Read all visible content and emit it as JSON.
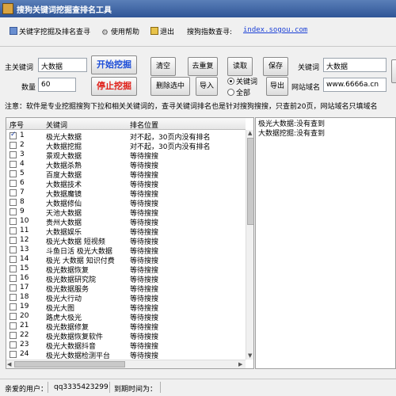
{
  "window": {
    "title": "搜狗关键词挖掘查排名工具"
  },
  "menu": {
    "item1": "关键字挖掘及排名查寻",
    "item2": "使用帮助",
    "item3": "退出",
    "index_label": "搜狗指数查寻:",
    "index_link": "index.sogou.com"
  },
  "form": {
    "main_keyword_label": "主关键词",
    "main_keyword_value": "大数据",
    "count_label": "数量",
    "count_value": "60",
    "start_button": "开始挖掘",
    "stop_button": "停止挖掘",
    "clear_button": "清空",
    "dedupe_button": "去重复",
    "read_button": "读取",
    "save_button": "保存",
    "delete_selected_button": "删除选中",
    "import_button": "导入",
    "radio_keyword": "关键词",
    "radio_all": "全部",
    "export_button": "导出",
    "keyword_label": "关键词",
    "keyword_value": "大数据",
    "domain_label": "网站域名",
    "domain_value": "www.6666a.cn"
  },
  "notice": "注意：软件是专业挖掘搜狗下拉和相关关键词的，查寻关键词排名也是针对搜狗搜搜，只查前20页，网站域名只填域名",
  "table": {
    "col_no": "序号",
    "col_keyword": "关键词",
    "col_status": "排名位置",
    "rows": [
      {
        "no": "1",
        "kw": "极光大数据",
        "st": "对不起，30页内没有排名",
        "checked": true
      },
      {
        "no": "2",
        "kw": "大数据挖掘",
        "st": "对不起，30页内没有排名",
        "checked": false
      },
      {
        "no": "3",
        "kw": "景观大数据",
        "st": "等待搜搜",
        "checked": false
      },
      {
        "no": "4",
        "kw": "大数据杀熟",
        "st": "等待搜搜",
        "checked": false
      },
      {
        "no": "5",
        "kw": "百度大数据",
        "st": "等待搜搜",
        "checked": false
      },
      {
        "no": "6",
        "kw": "大数据技术",
        "st": "等待搜搜",
        "checked": false
      },
      {
        "no": "7",
        "kw": "大数据魔镜",
        "st": "等待搜搜",
        "checked": false
      },
      {
        "no": "8",
        "kw": "大数据修仙",
        "st": "等待搜搜",
        "checked": false
      },
      {
        "no": "9",
        "kw": "天池大数据",
        "st": "等待搜搜",
        "checked": false
      },
      {
        "no": "10",
        "kw": "贵州大数据",
        "st": "等待搜搜",
        "checked": false
      },
      {
        "no": "11",
        "kw": "大数据娱乐",
        "st": "等待搜搜",
        "checked": false
      },
      {
        "no": "12",
        "kw": "极光大数据 短视频",
        "st": "等待搜搜",
        "checked": false
      },
      {
        "no": "13",
        "kw": "斗鱼日活 极光大数据",
        "st": "等待搜搜",
        "checked": false
      },
      {
        "no": "14",
        "kw": "极光 大数据 知识付费",
        "st": "等待搜搜",
        "checked": false
      },
      {
        "no": "15",
        "kw": "极光数据恢复",
        "st": "等待搜搜",
        "checked": false
      },
      {
        "no": "16",
        "kw": "极光数据研究院",
        "st": "等待搜搜",
        "checked": false
      },
      {
        "no": "17",
        "kw": "极光数据服务",
        "st": "等待搜搜",
        "checked": false
      },
      {
        "no": "18",
        "kw": "极光大行动",
        "st": "等待搜搜",
        "checked": false
      },
      {
        "no": "19",
        "kw": "极光大图",
        "st": "等待搜搜",
        "checked": false
      },
      {
        "no": "20",
        "kw": "路虎大极光",
        "st": "等待搜搜",
        "checked": false
      },
      {
        "no": "21",
        "kw": "极光数据修复",
        "st": "等待搜搜",
        "checked": false
      },
      {
        "no": "22",
        "kw": "极光数据恢复软件",
        "st": "等待搜搜",
        "checked": false
      },
      {
        "no": "23",
        "kw": "极光大数据抖音",
        "st": "等待搜搜",
        "checked": false
      },
      {
        "no": "24",
        "kw": "极光大数据检测平台",
        "st": "等待搜搜",
        "checked": false
      }
    ]
  },
  "log": [
    "极光大数据:没有查到",
    "大数据挖掘:没有查到"
  ],
  "status": {
    "user_label": "亲爱的用户：",
    "user_value": "qq3335423299",
    "expire_label": "到期时间为："
  }
}
